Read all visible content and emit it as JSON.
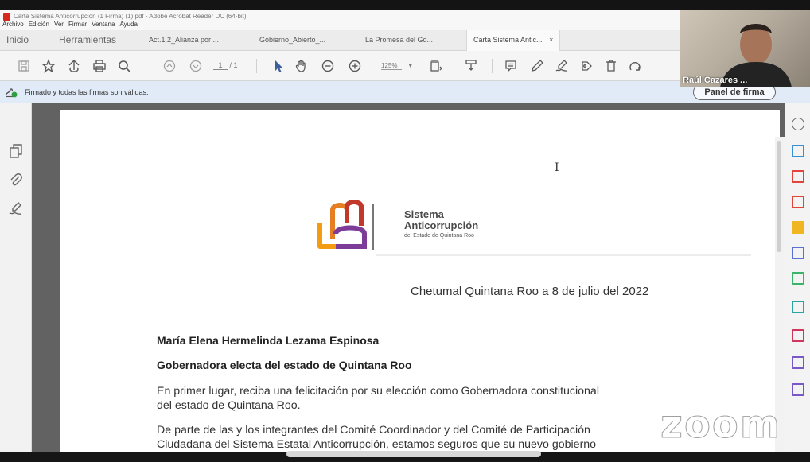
{
  "window": {
    "title": "Carta Sistema Anticorrupción (1 Firma) (1).pdf - Adobe Acrobat Reader DC (64-bit)"
  },
  "menu": [
    "Archivo",
    "Edición",
    "Ver",
    "Firmar",
    "Ventana",
    "Ayuda"
  ],
  "tabs": {
    "home": "Inicio",
    "tools": "Herramientas",
    "docs": [
      "Act.1.2_Alianza por ...",
      "Gobierno_Abierto_...",
      "La Promesa del Go...",
      "Carta Sistema Antic..."
    ],
    "close": "×"
  },
  "toolbar": {
    "page_current": "1",
    "page_total": "/ 1",
    "zoom": "125%",
    "zoom_caret": "▾"
  },
  "signature_bar": {
    "message": "Firmado y todas las firmas son válidas.",
    "panel_button": "Panel de firma"
  },
  "letter": {
    "org_line1": "Sistema",
    "org_line2": "Anticorrupción",
    "org_line3": "del Estado de Quintana Roo",
    "date": "Chetumal Quintana Roo a 8 de julio del 2022",
    "recipient_name": "María Elena Hermelinda Lezama Espinosa",
    "recipient_title": "Gobernadora electa del estado de Quintana Roo",
    "p1_line1": "En primer lugar, reciba una felicitación por su elección como Gobernadora constitucional",
    "p1_line2": "del estado de Quintana Roo.",
    "p2_line1": "De parte de las y los integrantes del Comité Coordinador y del Comité de Participación",
    "p2_line2": "Ciudadana del Sistema Estatal Anticorrupción, estamos seguros que su nuevo gobierno"
  },
  "video": {
    "participant_name": "Raúl Cazares ..."
  },
  "watermark": "zoom",
  "colors": {
    "acrobat_red": "#d8281d",
    "signature_bar": "#e1eaf7",
    "logo_orange": "#f39c12",
    "logo_red": "#c0392b",
    "logo_purple": "#7d3c98"
  }
}
